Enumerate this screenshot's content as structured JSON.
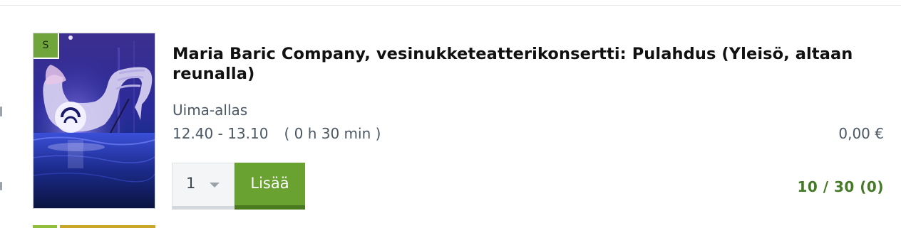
{
  "event": {
    "badge": "S",
    "title": "Maria Baric Company, vesinukketeatterikonsertti: Pulahdus (Yleisö, altaan reunalla)",
    "location": "Uima-allas",
    "time_range": "12.40 - 13.10",
    "duration": "( 0 h 30 min )",
    "price": "0,00 €",
    "quantity": "1",
    "add_label": "Lisää",
    "availability": "10 / 30 (0)",
    "image_alt": "Swan-shaped inflatable in a dark blue-lit pool"
  },
  "colors": {
    "accent_green": "#6aa232",
    "availability_green": "#447a26",
    "badge_green": "#6fa53a",
    "next_item_strip_green": "#8fbf3a",
    "next_item_strip_gold": "#c9a62a"
  }
}
